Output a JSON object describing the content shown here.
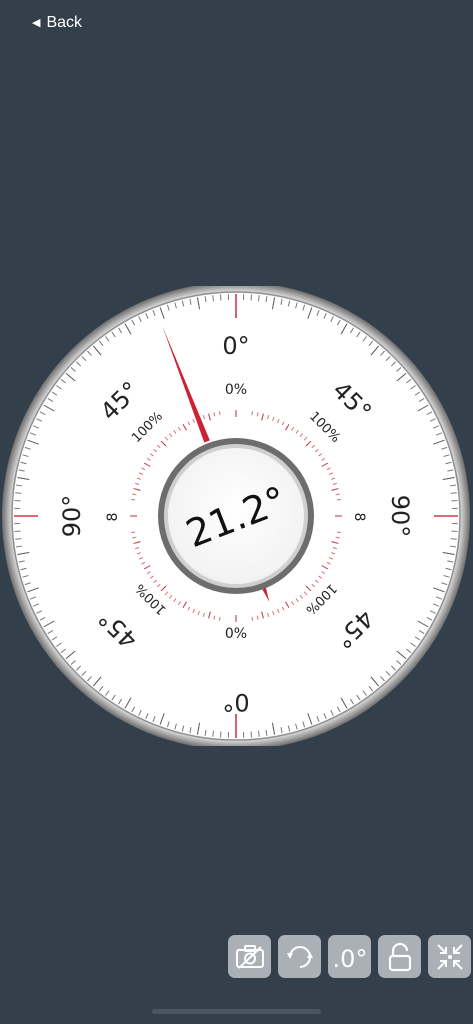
{
  "nav": {
    "back_label": "Back"
  },
  "dial": {
    "reading": "21.2°",
    "outer_labels": {
      "top": "0°",
      "upper_left": "45°",
      "upper_right": "45°",
      "left": "90°",
      "right": "90°",
      "lower_left": "45°",
      "lower_right": "45°",
      "bottom": "0°"
    },
    "inner_labels": {
      "top": "0%",
      "bottom": "0%",
      "upper_left": "100%",
      "upper_right": "100%",
      "lower_left": "100%",
      "lower_right": "100%",
      "left": "8",
      "right": "8"
    },
    "angle_degrees": 21.2,
    "needle_color": "#cc2233",
    "accent_color": "#d23a44"
  },
  "toolbar": {
    "buttons": [
      {
        "icon": "camera-off-icon"
      },
      {
        "icon": "calibrate-rotate-icon"
      },
      {
        "icon": "decimal-degree-icon",
        "label": ".0°"
      },
      {
        "icon": "unlock-icon"
      },
      {
        "icon": "collapse-arrows-icon"
      }
    ]
  }
}
